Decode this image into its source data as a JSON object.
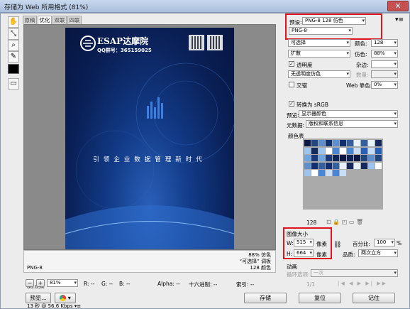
{
  "window": {
    "title": "存储为 Web 所用格式 (81%)",
    "close_glyph": "✕"
  },
  "tabs": [
    "原稿",
    "优化",
    "双联",
    "四联"
  ],
  "poster": {
    "brand": "ESAP达摩院",
    "qq": "QQ群号：365159025",
    "slogan": "引领企业数据管理新时代"
  },
  "info_left": {
    "format": "PNG-8",
    "size": "66.03K",
    "time": "13 秒 @ 56.6 Kbps",
    "menu": "▾≡"
  },
  "info_right": {
    "quality": "88% 仿色",
    "palette": "“可选择” 调板",
    "colors": "128 颜色"
  },
  "zoom": {
    "minus": "−",
    "plus": "+",
    "value": "81%"
  },
  "pixel": {
    "r": "R: --",
    "g": "G: --",
    "b": "B: --",
    "alpha": "Alpha: --",
    "hex": "十六进制: --",
    "index": "索引: --"
  },
  "buttons": {
    "preview": "预览...",
    "save": "存储",
    "reset": "复位",
    "remember": "记住"
  },
  "settings": {
    "preset_label": "预设:",
    "preset_value": "PNG-8 128 仿色",
    "format": "PNG-8",
    "reduction": "可选择",
    "colors_label": "颜色:",
    "colors_value": "128",
    "dither_algo": "扩散",
    "dither_label": "仿色:",
    "dither_value": "88%",
    "transparency_label": "透明度",
    "matte_label": "杂边:",
    "trans_dither": "无透明度仿色",
    "amount_label": "数量:",
    "interlaced_label": "交错",
    "web_snap_label": "Web 靠色:",
    "web_snap_value": "0%",
    "convert_srgb_label": "转换为 sRGB",
    "preview_label": "预览:",
    "preview_value": "显示器颜色",
    "metadata_label": "元数据:",
    "metadata_value": "版权和联系信息",
    "color_table_label": "颜色表",
    "color_count": "128"
  },
  "image_size": {
    "title": "图像大小",
    "w_label": "W:",
    "w_value": "515",
    "unit": "像素",
    "h_label": "H:",
    "h_value": "664",
    "percent_label": "百分比:",
    "percent_value": "100",
    "percent_unit": "%",
    "quality_label": "品质:",
    "quality_value": "两次立方"
  },
  "animation": {
    "title": "动画",
    "loop_label": "循环选项:",
    "loop_value": "一次",
    "frame": "1/1"
  },
  "palette_colors": [
    "#0b1a44",
    "#1a3a7a",
    "#2a5fb8",
    "#4a86d6",
    "#9cc4ee",
    "#e8f2ff",
    "#103070",
    "#20457f",
    "#0e2656",
    "#6ea6e0",
    "#c9def5",
    "#ffffff",
    "#152a5c",
    "#355f9f",
    "#5e8ecb"
  ]
}
